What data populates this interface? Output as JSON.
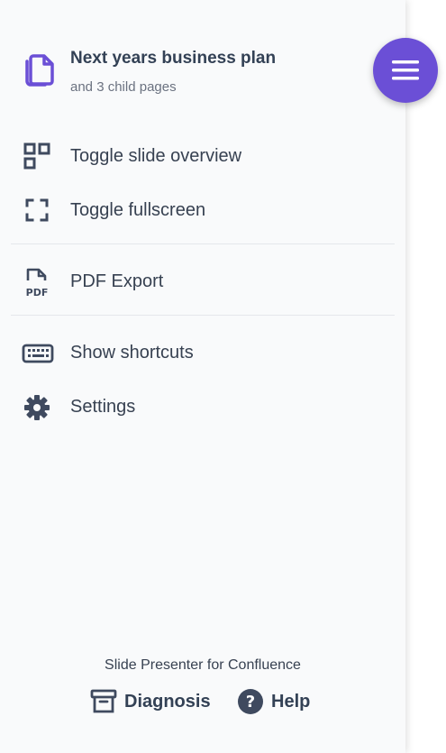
{
  "header": {
    "title": "Next years business plan",
    "subtitle": "and 3 child pages",
    "icon": "copy-pages-icon"
  },
  "menu_button": {
    "icon": "hamburger-menu-icon",
    "color": "#6b4fd6"
  },
  "menu": {
    "items": [
      {
        "label": "Toggle slide overview",
        "icon": "grid-overview-icon"
      },
      {
        "label": "Toggle fullscreen",
        "icon": "fullscreen-icon"
      },
      {
        "label": "PDF Export",
        "icon": "pdf-file-icon"
      },
      {
        "label": "Show shortcuts",
        "icon": "keyboard-icon"
      },
      {
        "label": "Settings",
        "icon": "gear-icon"
      }
    ]
  },
  "footer": {
    "brand": "Slide Presenter for Confluence",
    "diagnosis_label": "Diagnosis",
    "help_label": "Help"
  },
  "colors": {
    "accent": "#6b4fd6",
    "text": "#374151",
    "icon": "#3f4a5f"
  }
}
